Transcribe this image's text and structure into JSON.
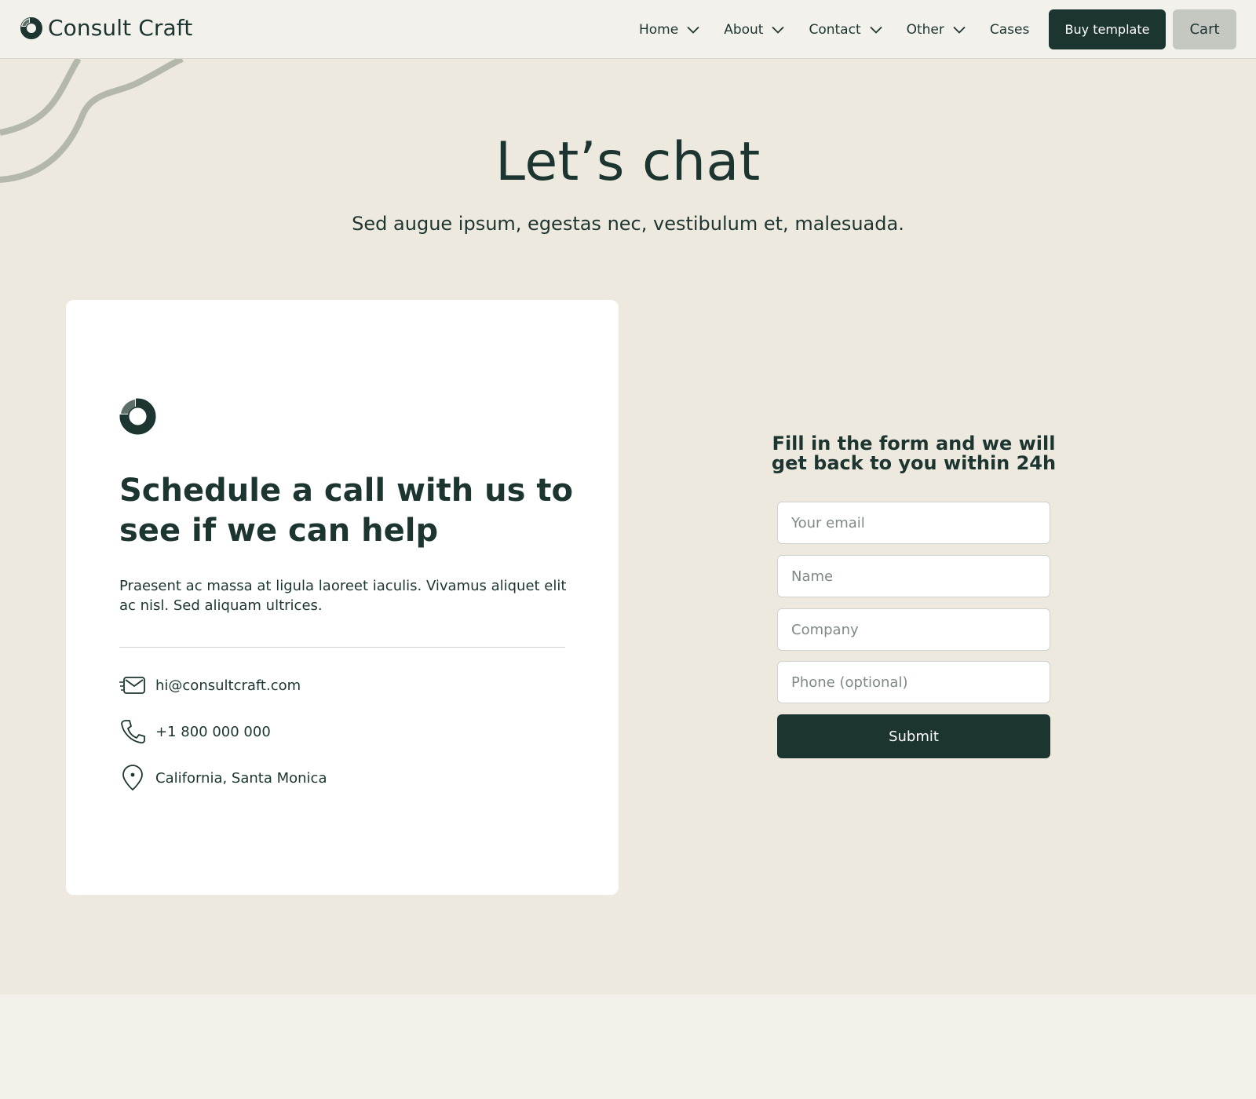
{
  "header": {
    "brand_name": "Consult Craft",
    "nav": [
      {
        "label": "Home",
        "has_dropdown": true
      },
      {
        "label": "About",
        "has_dropdown": true
      },
      {
        "label": "Contact",
        "has_dropdown": true
      },
      {
        "label": "Other",
        "has_dropdown": true
      },
      {
        "label": "Cases",
        "has_dropdown": false
      }
    ],
    "buy_label": "Buy template",
    "cart_label": "Cart"
  },
  "hero": {
    "title": "Let’s chat",
    "subtitle": "Sed augue ipsum, egestas nec, vestibulum et, malesuada."
  },
  "card": {
    "title": "Schedule a call with us to see if we can help",
    "text": "Praesent ac massa at ligula laoreet iaculis. Vivamus aliquet elit ac nisl. Sed aliquam ultrices.",
    "contacts": [
      {
        "icon": "mail-icon",
        "value": "hi@consultcraft.com"
      },
      {
        "icon": "phone-icon",
        "value": "+1 800 000 000"
      },
      {
        "icon": "location-pin-icon",
        "value": "California, Santa Monica"
      }
    ]
  },
  "form": {
    "heading": "Fill in the form and we will get back to you within 24h",
    "fields": {
      "email_placeholder": "Your email",
      "name_placeholder": "Name",
      "company_placeholder": "Company",
      "phone_placeholder": "Phone (optional)"
    },
    "submit_label": "Submit"
  },
  "colors": {
    "primary": "#1c3530",
    "section_bg": "#ede9df",
    "page_bg": "#f3f0ea",
    "accent_soft": "#c4c8c1",
    "decoration": "#b4b8ac"
  }
}
